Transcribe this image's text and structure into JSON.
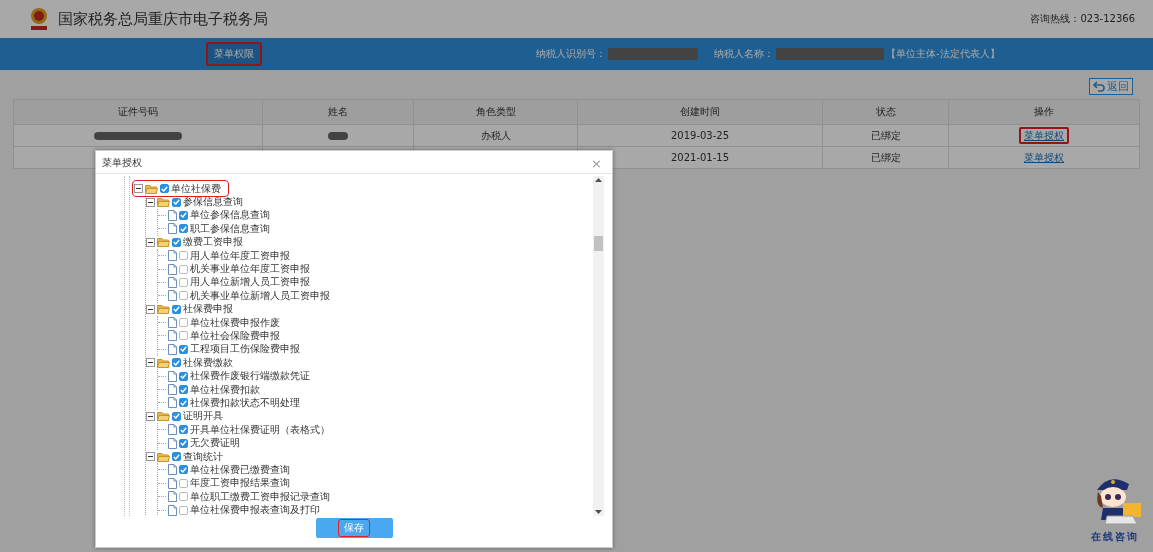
{
  "header": {
    "title": "国家税务总局重庆市电子税务局",
    "hotline": "咨询热线：023-12366"
  },
  "nav": {
    "tabs": [
      {
        "label": "菜单权限",
        "selected": true,
        "highlighted": true
      }
    ],
    "taxpayer_id": {
      "label": "纳税人识别号：",
      "redacted": true
    },
    "taxpayer_name": {
      "label": "纳税人名称：",
      "redacted": true,
      "suffix": "【单位主体-法定代表人】"
    }
  },
  "back_button": {
    "label": "返回"
  },
  "table": {
    "columns": [
      "证件号码",
      "姓名",
      "角色类型",
      "创建时间",
      "状态",
      "操作"
    ],
    "rows": [
      {
        "id_number": {
          "redacted": true
        },
        "name": {
          "redacted": true
        },
        "role": "办税人",
        "created": "2019-03-25",
        "status": "已绑定",
        "action": {
          "label": "菜单授权",
          "highlighted": true
        }
      },
      {
        "created": "2021-01-15",
        "status": "已绑定",
        "action": {
          "label": "菜单授权",
          "highlighted": false
        }
      }
    ]
  },
  "dialog": {
    "title": "菜单授权",
    "close": "×",
    "tree": [
      {
        "label": "单位社保费",
        "checked": true,
        "expanded": true,
        "highlighted": true,
        "children": [
          {
            "label": "参保信息查询",
            "checked": true,
            "expanded": true,
            "children": [
              {
                "label": "单位参保信息查询",
                "checked": true
              },
              {
                "label": "职工参保信息查询",
                "checked": true
              }
            ]
          },
          {
            "label": "缴费工资申报",
            "checked": true,
            "expanded": true,
            "children": [
              {
                "label": "用人单位年度工资申报",
                "checked": false
              },
              {
                "label": "机关事业单位年度工资申报",
                "checked": false
              },
              {
                "label": "用人单位新增人员工资申报",
                "checked": false
              },
              {
                "label": "机关事业单位新增人员工资申报",
                "checked": false
              }
            ]
          },
          {
            "label": "社保费申报",
            "checked": true,
            "expanded": true,
            "children": [
              {
                "label": "单位社保费申报作废",
                "checked": false
              },
              {
                "label": "单位社会保险费申报",
                "checked": false
              },
              {
                "label": "工程项目工伤保险费申报",
                "checked": true
              }
            ]
          },
          {
            "label": "社保费缴款",
            "checked": true,
            "expanded": true,
            "children": [
              {
                "label": "社保费作废银行端缴款凭证",
                "checked": true
              },
              {
                "label": "单位社保费扣款",
                "checked": true
              },
              {
                "label": "社保费扣款状态不明处理",
                "checked": true
              }
            ]
          },
          {
            "label": "证明开具",
            "checked": true,
            "expanded": true,
            "children": [
              {
                "label": "开具单位社保费证明（表格式）",
                "checked": true
              },
              {
                "label": "无欠费证明",
                "checked": true
              }
            ]
          },
          {
            "label": "查询统计",
            "checked": true,
            "expanded": true,
            "children": [
              {
                "label": "单位社保费已缴费查询",
                "checked": true
              },
              {
                "label": "年度工资申报结果查询",
                "checked": false
              },
              {
                "label": "单位职工缴费工资申报记录查询",
                "checked": false
              },
              {
                "label": "单位社保费申报表查询及打印",
                "checked": false
              }
            ]
          }
        ]
      }
    ],
    "save_button": {
      "label": "保存",
      "highlighted": true
    }
  },
  "assistant": {
    "label": "在线咨询"
  }
}
